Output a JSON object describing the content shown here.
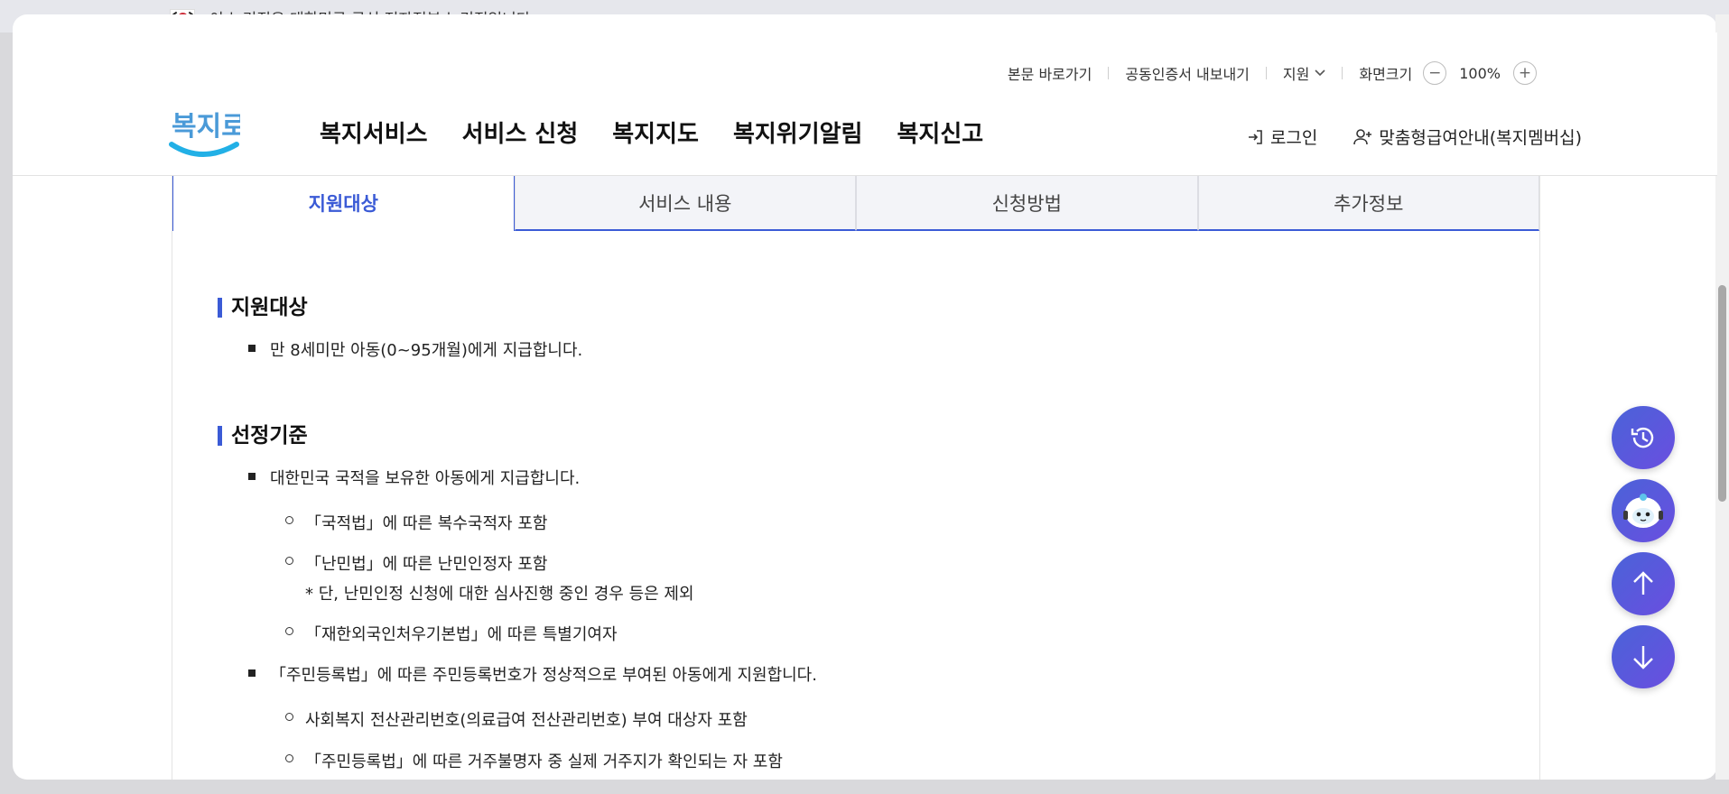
{
  "gov_banner": {
    "text": "이 누리집은 대한민국 공식 전자정부 누리집입니다."
  },
  "utility": {
    "skip": "본문 바로가기",
    "cert": "공동인증서 내보내기",
    "support": "지원",
    "screen_size": "화면크기",
    "zoom_value": "100%"
  },
  "logo": {
    "text": "복지로"
  },
  "gnb": [
    "복지서비스",
    "서비스 신청",
    "복지지도",
    "복지위기알림",
    "복지신고"
  ],
  "member": {
    "login": "로그인",
    "membership": "맞춤형급여안내(복지멤버십)"
  },
  "tabs": [
    "지원대상",
    "서비스 내용",
    "신청방법",
    "추가정보"
  ],
  "sections": {
    "target": {
      "title": "지원대상",
      "items": [
        "만 8세미만 아동(0~95개월)에게 지급합니다."
      ]
    },
    "criteria": {
      "title": "선정기준",
      "item1": "대한민국 국적을 보유한 아동에게 지급합니다.",
      "sub1": "「국적법」에 따른 복수국적자 포함",
      "sub2": "「난민법」에 따른 난민인정자 포함",
      "sub2_note": "* 단, 난민인정 신청에 대한 심사진행 중인 경우 등은 제외",
      "sub3": "「재한외국인처우기본법」에 따른 특별기여자",
      "item2": "「주민등록법」에 따른 주민등록번호가 정상적으로 부여된 아동에게 지원합니다.",
      "sub4": "사회복지 전산관리번호(의료급여 전산관리번호) 부여 대상자 포함",
      "sub5": "「주민등록법」에 따른 거주불명자 중 실제 거주지가 확인되는 자 포함"
    }
  },
  "colors": {
    "accent": "#3b5bd6",
    "fab": "#5a57dc"
  },
  "icons": [
    "flag-icon",
    "chevron-down-icon",
    "minus-icon",
    "plus-icon",
    "login-icon",
    "user-add-icon",
    "history-icon",
    "chatbot-icon",
    "arrow-up-icon",
    "arrow-down-icon"
  ]
}
